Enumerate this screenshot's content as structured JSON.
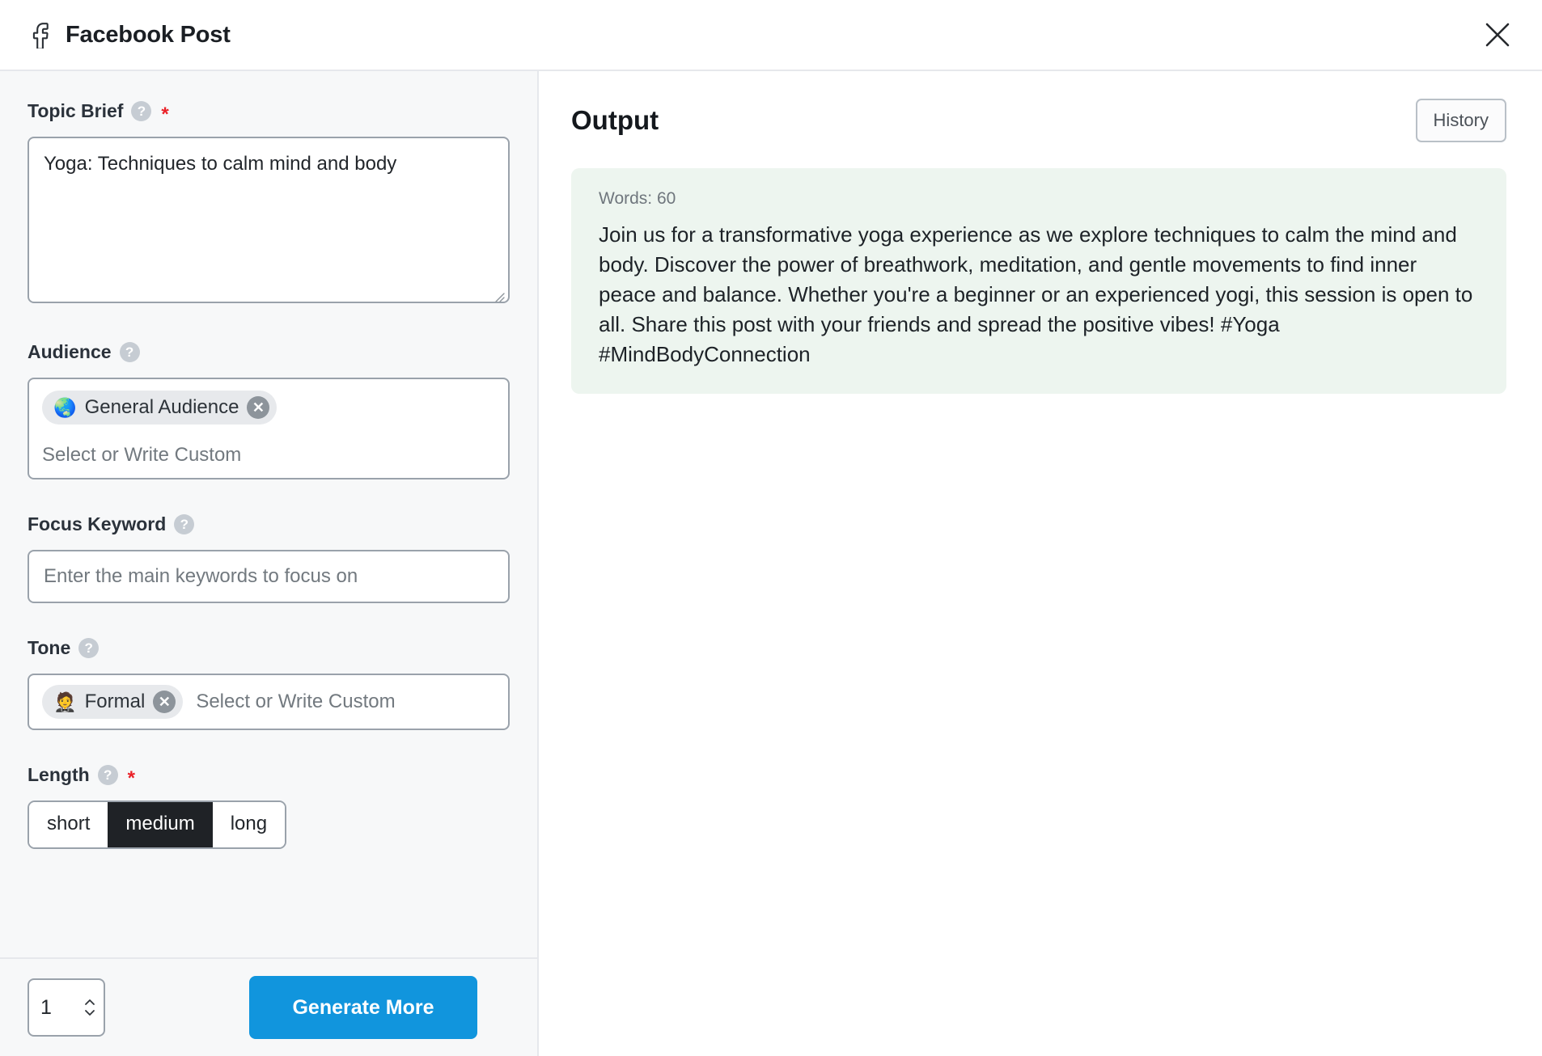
{
  "header": {
    "title": "Facebook Post",
    "platform_icon": "facebook-icon",
    "close_icon": "close-icon"
  },
  "form": {
    "topic_brief": {
      "label": "Topic Brief",
      "required_marker": "*",
      "help_icon": "help-icon",
      "value": "Yoga: Techniques to calm mind and body",
      "placeholder": ""
    },
    "audience": {
      "label": "Audience",
      "help_icon": "help-icon",
      "chips": [
        {
          "emoji": "🌏",
          "label": "General Audience",
          "remove_icon": "remove-chip-icon"
        }
      ],
      "placeholder": "Select or Write Custom"
    },
    "focus_keyword": {
      "label": "Focus Keyword",
      "help_icon": "help-icon",
      "value": "",
      "placeholder": "Enter the main keywords to focus on"
    },
    "tone": {
      "label": "Tone",
      "help_icon": "help-icon",
      "chips": [
        {
          "emoji": "🤵",
          "label": "Formal",
          "remove_icon": "remove-chip-icon"
        }
      ],
      "placeholder": "Select or Write Custom"
    },
    "length": {
      "label": "Length",
      "required_marker": "*",
      "help_icon": "help-icon",
      "options": [
        "short",
        "medium",
        "long"
      ],
      "selected": "medium"
    }
  },
  "footer": {
    "count_value": "1",
    "generate_label": "Generate More"
  },
  "output": {
    "title": "Output",
    "history_label": "History",
    "words_label": "Words: 60",
    "text": "Join us for a transformative yoga experience as we explore techniques to calm the mind and body. Discover the power of breathwork, meditation, and gentle movements to find inner peace and balance. Whether you're a beginner or an experienced yogi, this session is open to all. Share this post with your friends and spread the positive vibes! #Yoga #MindBodyConnection"
  },
  "colors": {
    "accent_blue": "#1195dd",
    "selected_dark": "#1f2226",
    "output_card_bg": "#edf5ef",
    "panel_bg": "#f7f8f9",
    "required_red": "#ea2027"
  }
}
